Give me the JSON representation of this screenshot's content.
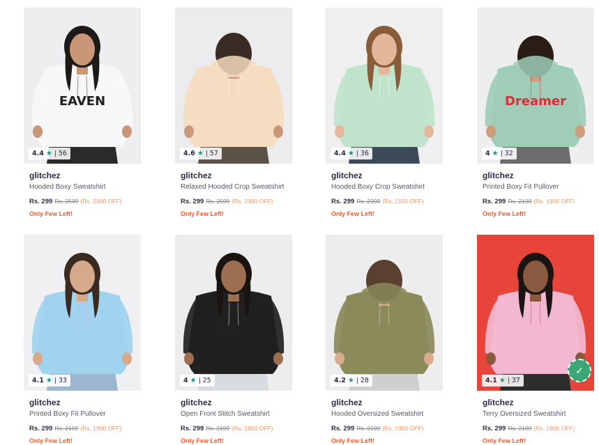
{
  "products": [
    {
      "brand": "glitchez",
      "name": "Hooded Boxy Sweatshirt",
      "rating": "4.4",
      "count": "56",
      "price": "Rs. 299",
      "mrp": "Rs. 2599",
      "off": "(Rs. 2300 OFF)",
      "stock": "Only Few Left!",
      "bg": "#eeeef0",
      "garment": "#f7f7f7",
      "skin": "#c99777",
      "hair": "#1d1a18",
      "print": "EAVEN",
      "printColor": "#222222",
      "pants": "#2a2a2a"
    },
    {
      "brand": "glitchez",
      "name": "Relaxed Hooded Crop Sweatshirt",
      "rating": "4.6",
      "count": "57",
      "price": "Rs. 299",
      "mrp": "Rs. 2599",
      "off": "(Rs. 2300 OFF)",
      "stock": "Only Few Left!",
      "bg": "#ececee",
      "garment": "#f6dcc0",
      "skin": "#c9987a",
      "hair": "#3a2c24",
      "print": "",
      "printColor": "#ffffff",
      "pants": "#5a5348"
    },
    {
      "brand": "glitchez",
      "name": "Hooded Boxy Crop Sweatshirt",
      "rating": "4.4",
      "count": "36",
      "price": "Rs. 299",
      "mrp": "Rs. 2399",
      "off": "(Rs. 2100 OFF)",
      "stock": "Only Few Left!",
      "bg": "#efefef",
      "garment": "#bfe3cb",
      "skin": "#e3b89a",
      "hair": "#8a5d3a",
      "print": "",
      "printColor": "#ffffff",
      "pants": "#3c4a5a"
    },
    {
      "brand": "glitchez",
      "name": "Printed Boxy Fit Pullover",
      "rating": "4",
      "count": "32",
      "price": "Rs. 299",
      "mrp": "Rs. 2199",
      "off": "(Rs. 1900 OFF)",
      "stock": "Only Few Left!",
      "bg": "#eeeeee",
      "garment": "#9fcdb7",
      "skin": "#cf9c7c",
      "hair": "#2a1d16",
      "print": "Dreamer",
      "printColor": "#d7303a",
      "pants": "#6c6c6c"
    },
    {
      "brand": "glitchez",
      "name": "Printed Boxy Fit Pullover",
      "rating": "4.1",
      "count": "33",
      "price": "Rs. 299",
      "mrp": "Rs. 2199",
      "off": "(Rs. 1900 OFF)",
      "stock": "Only Few Left!",
      "bg": "#f0f0f2",
      "garment": "#9fd3ee",
      "skin": "#d7a98a",
      "hair": "#3a2a20",
      "print": "",
      "printColor": "#f2a5c3",
      "pants": "#9cb6d0"
    },
    {
      "brand": "glitchez",
      "name": "Open Front Stitch Sweatshirt",
      "rating": "4",
      "count": "25",
      "price": "Rs. 299",
      "mrp": "Rs. 2199",
      "off": "(Rs. 1900 OFF)",
      "stock": "Only Few Left!",
      "bg": "#ededed",
      "garment": "#202020",
      "skin": "#9c6e52",
      "hair": "#1a1410",
      "print": "",
      "printColor": "#ffffff",
      "pants": "#d8dbe0"
    },
    {
      "brand": "glitchez",
      "name": "Hooded Oversized Sweatshirt",
      "rating": "4.2",
      "count": "28",
      "price": "Rs. 299",
      "mrp": "Rs. 2199",
      "off": "(Rs. 1900 OFF)",
      "stock": "Only Few Left!",
      "bg": "#ededed",
      "garment": "#8a8a5a",
      "skin": "#d9ab8e",
      "hair": "#5a4030",
      "print": "",
      "printColor": "#e9e4cf",
      "pants": "#cfcfcf"
    },
    {
      "brand": "glitchez",
      "name": "Terry Oversized Sweatshirt",
      "rating": "4.1",
      "count": "37",
      "price": "Rs. 299",
      "mrp": "Rs. 2199",
      "off": "(Rs. 1900 OFF)",
      "stock": "Only Few Left!",
      "bg": "#e8453a",
      "garment": "#f3b8d0",
      "skin": "#8a5a40",
      "hair": "#1a1512",
      "print": "",
      "printColor": "#b03a5a",
      "pants": "#2e2e2e"
    }
  ],
  "colors": {
    "accent": "#14958f",
    "offer": "#ff905a",
    "stock": "#ff5722",
    "text": "#282c3f"
  }
}
